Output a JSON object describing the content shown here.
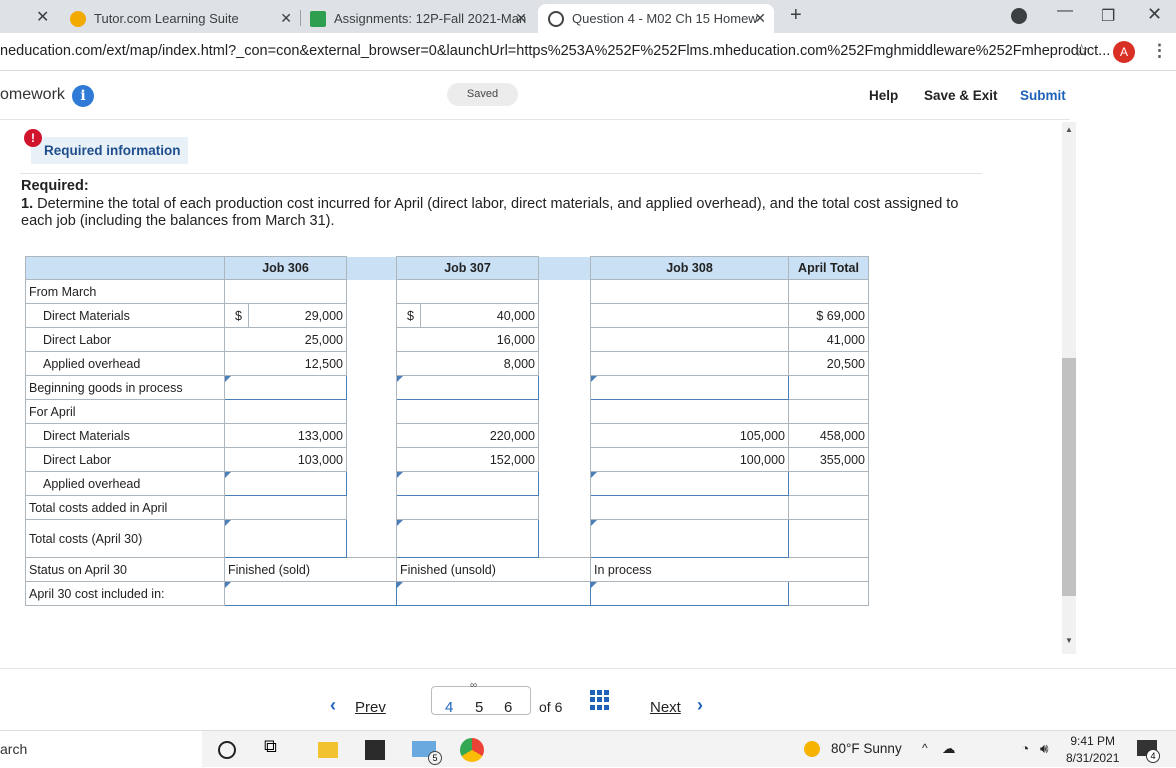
{
  "browser": {
    "tabs": [
      {
        "title": "Tutor.com Learning Suite"
      },
      {
        "title": "Assignments: 12P-Fall 2021-Man"
      },
      {
        "title": "Question 4 - M02 Ch 15 Homew"
      }
    ],
    "url": "neducation.com/ext/map/index.html?_con=con&external_browser=0&launchUrl=https%253A%252F%252Flms.mheducation.com%252Fmghmiddleware%252Fmheproduct...",
    "profile_initial": "A",
    "colors": {
      "tab_bar": "#dee1e6",
      "profile": "#d93025"
    }
  },
  "header": {
    "title": "omework",
    "saved_label": "Saved",
    "help_label": "Help",
    "save_exit_label": "Save & Exit",
    "submit_label": "Submit",
    "accent": "#1f63b8"
  },
  "content": {
    "required_info_label": "Required information",
    "required_title": "Required:",
    "question_number": "1.",
    "question_text": "Determine the total of each production cost incurred for April (direct labor, direct materials, and applied overhead), and the total cost assigned to each job (including the balances from March 31)."
  },
  "table": {
    "headers": [
      "",
      "Job 306",
      "Job 307",
      "Job 308",
      "April Total"
    ],
    "rows": {
      "from_march": "From March",
      "dm_label": "Direct Materials",
      "dm": {
        "j306_sym": "$",
        "j306": "29,000",
        "j307_sym": "$",
        "j307": "40,000",
        "total": "$  69,000"
      },
      "dl_label": "Direct Labor",
      "dl": {
        "j306": "25,000",
        "j307": "16,000",
        "total": "41,000"
      },
      "oh_label": "Applied overhead",
      "oh": {
        "j306": "12,500",
        "j307": "8,000",
        "total": "20,500"
      },
      "beginning_label": "Beginning goods in process",
      "for_april": "For April",
      "adm_label": "Direct Materials",
      "adm": {
        "j306": "133,000",
        "j307": "220,000",
        "j308": "105,000",
        "total": "458,000"
      },
      "adl_label": "Direct Labor",
      "adl": {
        "j306": "103,000",
        "j307": "152,000",
        "j308": "100,000",
        "total": "355,000"
      },
      "aoh_label": "Applied overhead",
      "added_label": "Total costs added in April",
      "total_label": "Total costs (April 30)",
      "status_label": "Status on April 30",
      "status": {
        "j306": "Finished (sold)",
        "j307": "Finished (unsold)",
        "j308": "In process"
      },
      "included_label": "April 30 cost included in:"
    },
    "colors": {
      "header_bg": "#c9e0f5",
      "input_border": "#4a7fb8"
    }
  },
  "pager": {
    "prev_label": "Prev",
    "pages": [
      "4",
      "5",
      "6"
    ],
    "of_label": "of 6",
    "next_label": "Next"
  },
  "taskbar": {
    "search_text": "arch",
    "weather": "80°F  Sunny",
    "time": "9:41 PM",
    "date": "8/31/2021",
    "mail_badge": "5",
    "notifications": "4"
  }
}
